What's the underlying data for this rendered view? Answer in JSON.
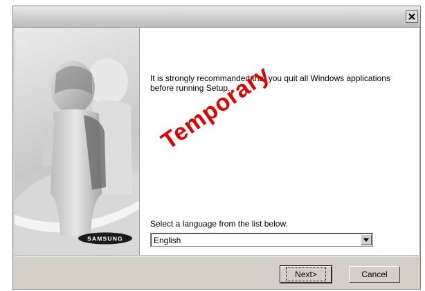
{
  "window": {
    "close_icon": "close-icon"
  },
  "content": {
    "message": "It is strongly recommanded that you quit all Windows applications before running Setup.",
    "watermark": "Temporary",
    "select_label": "Select a language from the list below.",
    "language_selected": "English",
    "brand_logo_text": "SAMSUNG"
  },
  "buttons": {
    "next": "Next>",
    "cancel": "Cancel"
  },
  "colors": {
    "watermark": "#e00000",
    "dialog_face": "#d4d0c8"
  }
}
